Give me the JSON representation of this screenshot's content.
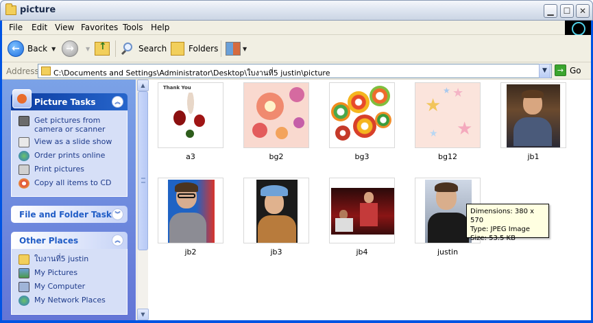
{
  "window": {
    "title": "picture"
  },
  "menu": [
    "File",
    "Edit",
    "View",
    "Favorites",
    "Tools",
    "Help"
  ],
  "toolbar": {
    "back_label": "Back",
    "search_label": "Search",
    "folders_label": "Folders"
  },
  "address": {
    "label": "Address",
    "path": "C:\\Documents and Settings\\Administrator\\Desktop\\ใบงานที่5 justin\\picture",
    "go_label": "Go"
  },
  "panels": {
    "picture_tasks": {
      "title": "Picture Tasks",
      "items": [
        "Get pictures from camera or scanner",
        "View as a slide show",
        "Order prints online",
        "Print pictures",
        "Copy all items to CD"
      ]
    },
    "file_folder_tasks": {
      "title": "File and Folder Tasks"
    },
    "other_places": {
      "title": "Other Places",
      "items": [
        "ใบงานที่5 justin",
        "My Pictures",
        "My Computer",
        "My Network Places"
      ]
    }
  },
  "files": [
    "a3",
    "bg2",
    "bg3",
    "bg12",
    "jb1",
    "jb2",
    "jb3",
    "jb4",
    "justin"
  ],
  "thumb_text": {
    "thank_you": "Thank You"
  },
  "tooltip": {
    "dimensions": "Dimensions: 380 x 570",
    "type": "Type: JPEG Image",
    "size": "Size: 53.5 KB"
  }
}
